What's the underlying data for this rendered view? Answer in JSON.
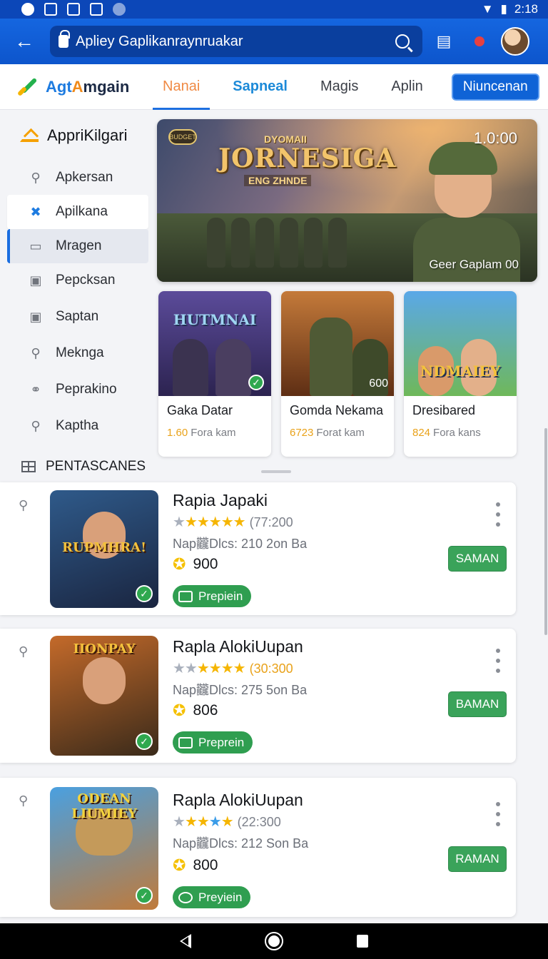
{
  "status_bar": {
    "time": "2:18"
  },
  "app_bar": {
    "search_value": "Apliey Gaplikanraynruakar"
  },
  "tabs": {
    "logo_part1": "Agt",
    "logo_part2": "A",
    "logo_part3": "mgain",
    "items": [
      "Nanai",
      "Sapneal",
      "Magis",
      "Aplin"
    ],
    "cta": "Niuncenan"
  },
  "sidebar": {
    "heading": "AppriKilgari",
    "items": [
      {
        "label": "Apkersan",
        "icon": "search-icon"
      },
      {
        "label": "Apilkana",
        "icon": "controller-icon"
      },
      {
        "label": "Mragen",
        "icon": "card-icon"
      },
      {
        "label": "Pepcksan",
        "icon": "bag-icon"
      },
      {
        "label": "Saptan",
        "icon": "bag-icon"
      },
      {
        "label": "Mekngа",
        "icon": "pin-icon"
      },
      {
        "label": "Peprakino",
        "icon": "tag-icon"
      },
      {
        "label": "Kaptha",
        "icon": "search-icon"
      }
    ],
    "section": "PENTASCANES"
  },
  "hero": {
    "badge": "BUDGET",
    "kicker": "DYOMAII",
    "title": "JORNESIGA",
    "subtitle": "ENG ZHNDE",
    "timer": "1.0:00",
    "caption": "Geer Gaplam 00"
  },
  "featured": [
    {
      "art_title": "HUTMNAI",
      "name": "Gaka Datar",
      "value": "1.60",
      "unit": "Fora kam"
    },
    {
      "art_title": "",
      "overlay": "600",
      "name": "Gomda Nekama",
      "value": "6723",
      "unit": "Forat kam"
    },
    {
      "art_title": "NDMAIEY",
      "name": "Dresibared",
      "value": "824",
      "unit": "Fora kans"
    }
  ],
  "list": [
    {
      "art_title": "RUPMHRA!",
      "title": "Rapia Japaki",
      "rating_count": "(77:200",
      "downloads": "Nap龖Dlcs: 210 2on Ba",
      "price": "900",
      "chip": "Prepiein",
      "action": "SAMAN"
    },
    {
      "art_title": "IIONPAY",
      "title": "Rapla AlokiUupan",
      "rating_count": "(30:300",
      "downloads": "Nap龖Dlcs: 275 5on Ba",
      "price": "806",
      "chip": "Preprein",
      "action": "BAMAN"
    },
    {
      "art_title": "ODEAN LIUMIEY",
      "title": "Rapla AlokiUupan",
      "rating_count": "(22:300",
      "downloads": "Nap龖Dlcs: 212 Son Ba",
      "price": "800",
      "chip": "Preyiein",
      "action": "RAMAN"
    }
  ],
  "colors": {
    "brand_blue": "#1566e0",
    "accent_green": "#3aa35a",
    "star_yellow": "#f5b500"
  }
}
